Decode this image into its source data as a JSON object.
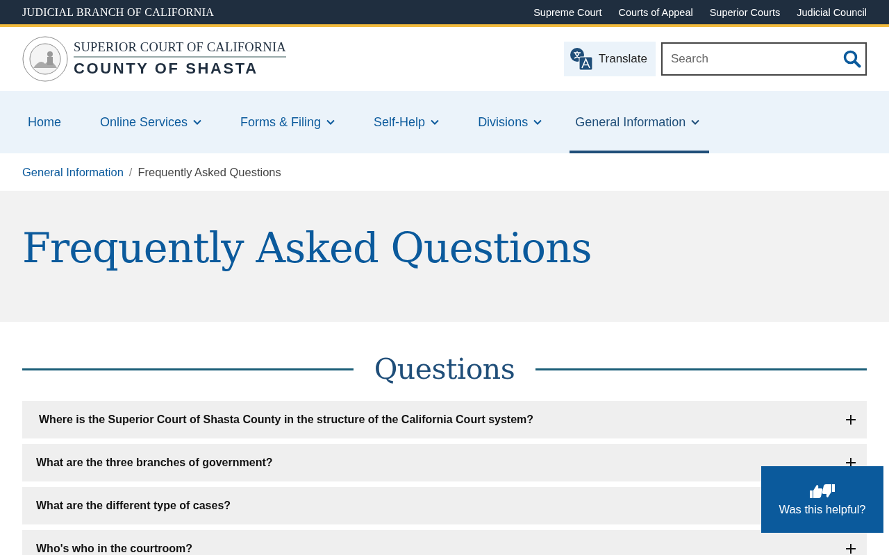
{
  "top_bar": {
    "title": "JUDICIAL BRANCH OF CALIFORNIA",
    "links": [
      "Supreme Court",
      "Courts of Appeal",
      "Superior Courts",
      "Judicial Council"
    ]
  },
  "header": {
    "court_line": "SUPERIOR COURT OF CALIFORNIA",
    "county_line": "COUNTY OF SHASTA",
    "translate": "Translate",
    "search": {
      "placeholder": "Search"
    }
  },
  "nav": [
    {
      "label": "Home",
      "has_menu": false,
      "selected": false
    },
    {
      "label": "Online Services",
      "has_menu": true,
      "selected": false
    },
    {
      "label": "Forms & Filing",
      "has_menu": true,
      "selected": false
    },
    {
      "label": "Self-Help",
      "has_menu": true,
      "selected": false
    },
    {
      "label": "Divisions",
      "has_menu": true,
      "selected": false
    },
    {
      "label": "General Information",
      "has_menu": true,
      "selected": true
    }
  ],
  "breadcrumb": {
    "separator": "/",
    "items": [
      {
        "label": "General Information",
        "link": true
      },
      {
        "label": "Frequently Asked Questions",
        "link": false
      }
    ]
  },
  "page_title": "Frequently Asked Questions",
  "section_title": "Questions",
  "faq": [
    {
      "question": "Where is the Superior Court of Shasta County in the structure of the California Court system?",
      "expanded": false
    },
    {
      "question": "What are the three branches of government?",
      "expanded": false
    },
    {
      "question": "What are the different type of cases?",
      "expanded": false
    },
    {
      "question": "Who's who in the courtroom?",
      "expanded": false
    }
  ],
  "feedback": {
    "label": "Was this helpful?"
  }
}
